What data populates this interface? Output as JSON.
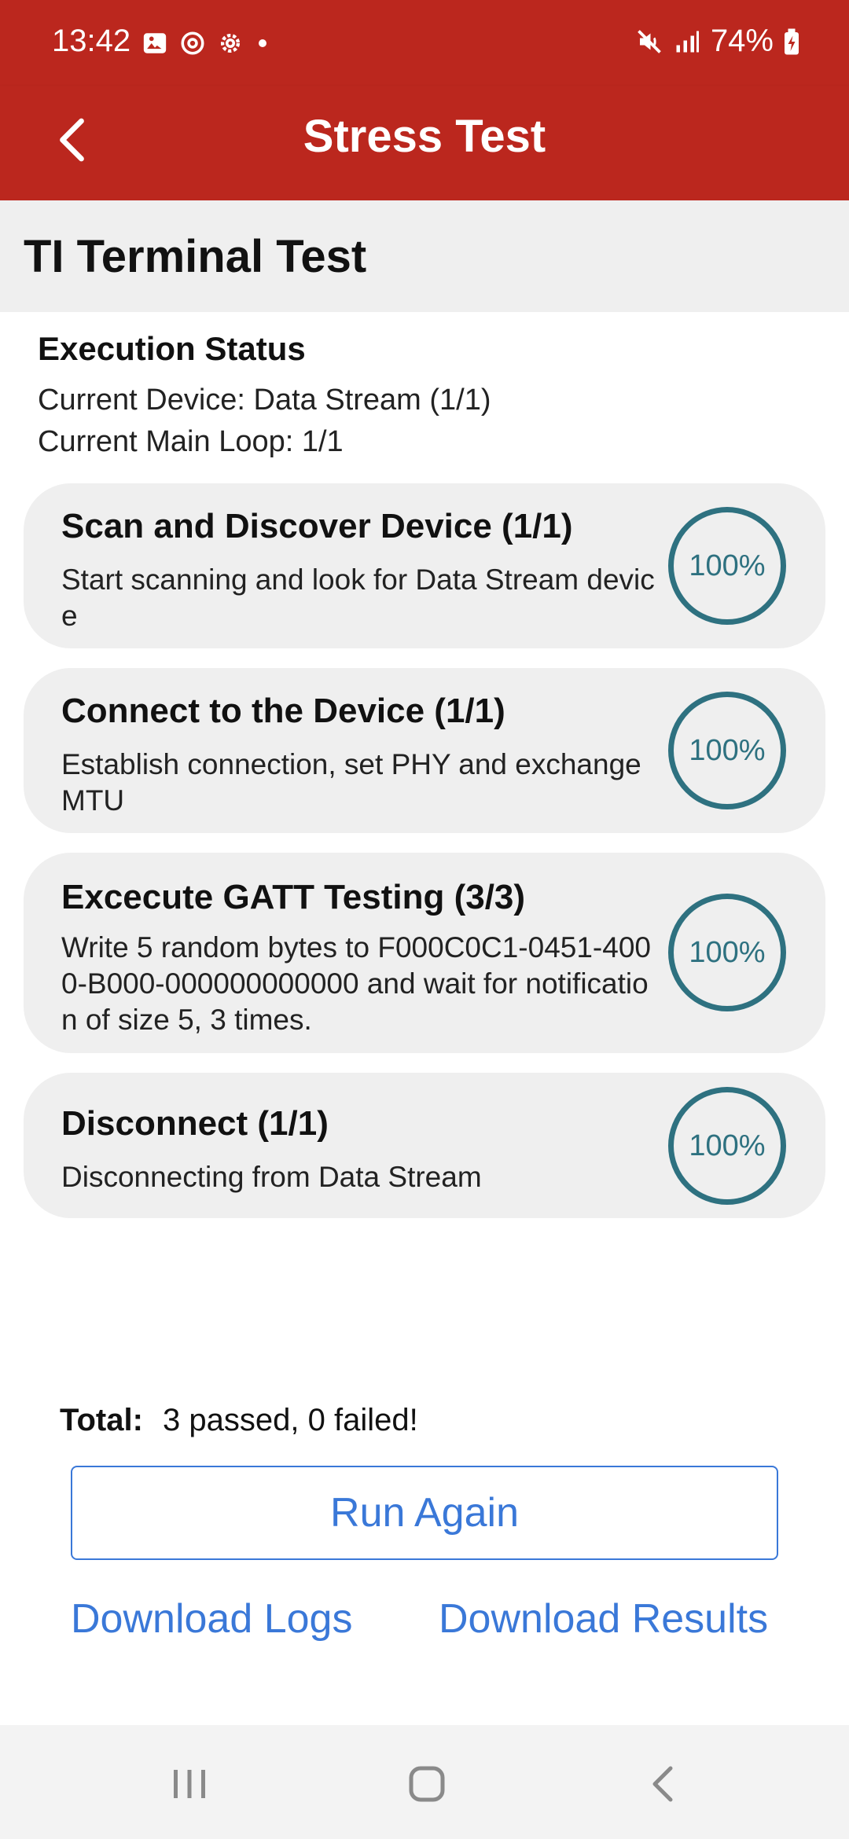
{
  "status_bar": {
    "time": "13:42",
    "battery": "74%",
    "icons": [
      "image-icon",
      "sync-icon",
      "settings-icon",
      "dot-icon",
      "mute-icon",
      "signal-icon",
      "battery-icon"
    ]
  },
  "app_bar": {
    "title": "Stress Test",
    "back_icon": "chevron-left-icon"
  },
  "section": {
    "title": "TI Terminal Test"
  },
  "execution": {
    "title": "Execution Status",
    "current_device": "Current Device: Data Stream (1/1)",
    "current_loop": "Current Main Loop: 1/1"
  },
  "steps": [
    {
      "title": "Scan and Discover Device (1/1)",
      "description": "Start scanning and look for Data Stream device",
      "progress_label": "100%",
      "progress": 1.0
    },
    {
      "title": "Connect to the Device (1/1)",
      "description": "Establish connection, set PHY and exchange MTU",
      "progress_label": "100%",
      "progress": 1.0
    },
    {
      "title": "Excecute GATT Testing (3/3)",
      "description": "Write 5 random bytes to F000C0C1-0451-4000-B000-000000000000 and wait for notification of size 5, 3 times.",
      "progress_label": "100%",
      "progress": 1.0
    },
    {
      "title": "Disconnect (1/1)",
      "description": "Disconnecting from Data Stream",
      "progress_label": "100%",
      "progress": 1.0
    }
  ],
  "summary": {
    "label": "Total:",
    "value": "3 passed, 0 failed!"
  },
  "actions": {
    "run_again": "Run Again",
    "download_logs": "Download Logs",
    "download_results": "Download Results"
  },
  "colors": {
    "header": "#bb271e",
    "ring": "#2e7180",
    "link": "#3a78d8",
    "card": "#efefef"
  }
}
